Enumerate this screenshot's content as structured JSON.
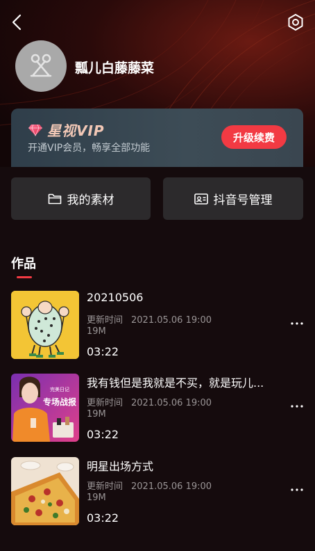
{
  "header": {
    "back_icon": "chevron-left-icon",
    "settings_icon": "hexagon-settings-icon"
  },
  "profile": {
    "username": "瓢儿白藤藤菜",
    "avatar_icon": "scissors-placeholder-icon"
  },
  "vip": {
    "title": "星视VIP",
    "subtitle": "开通VIP会员，畅享全部功能",
    "button_label": "升级续费",
    "accent": "#f23a43"
  },
  "actions": {
    "materials_label": "我的素材",
    "materials_icon": "folder-icon",
    "douyin_label": "抖音号管理",
    "douyin_icon": "id-card-icon"
  },
  "works": {
    "title": "作品",
    "items": [
      {
        "title": "20210506",
        "time_label": "更新时间",
        "time_value": "2021.05.06 19:00",
        "size": "19M",
        "duration": "03:22",
        "thumb": "cartoon-thumbnail"
      },
      {
        "title": "我有钱但是我就是不买，就是玩儿...",
        "time_label": "更新时间",
        "time_value": "2021.05.06 19:00",
        "size": "19M",
        "duration": "03:22",
        "thumb": "person-thumbnail",
        "thumb_text_1": "完美日记",
        "thumb_text_2": "专场战报"
      },
      {
        "title": "明星出场方式",
        "time_label": "更新时间",
        "time_value": "2021.05.06 19:00",
        "size": "19M",
        "duration": "03:22",
        "thumb": "pizza-thumbnail"
      }
    ]
  }
}
